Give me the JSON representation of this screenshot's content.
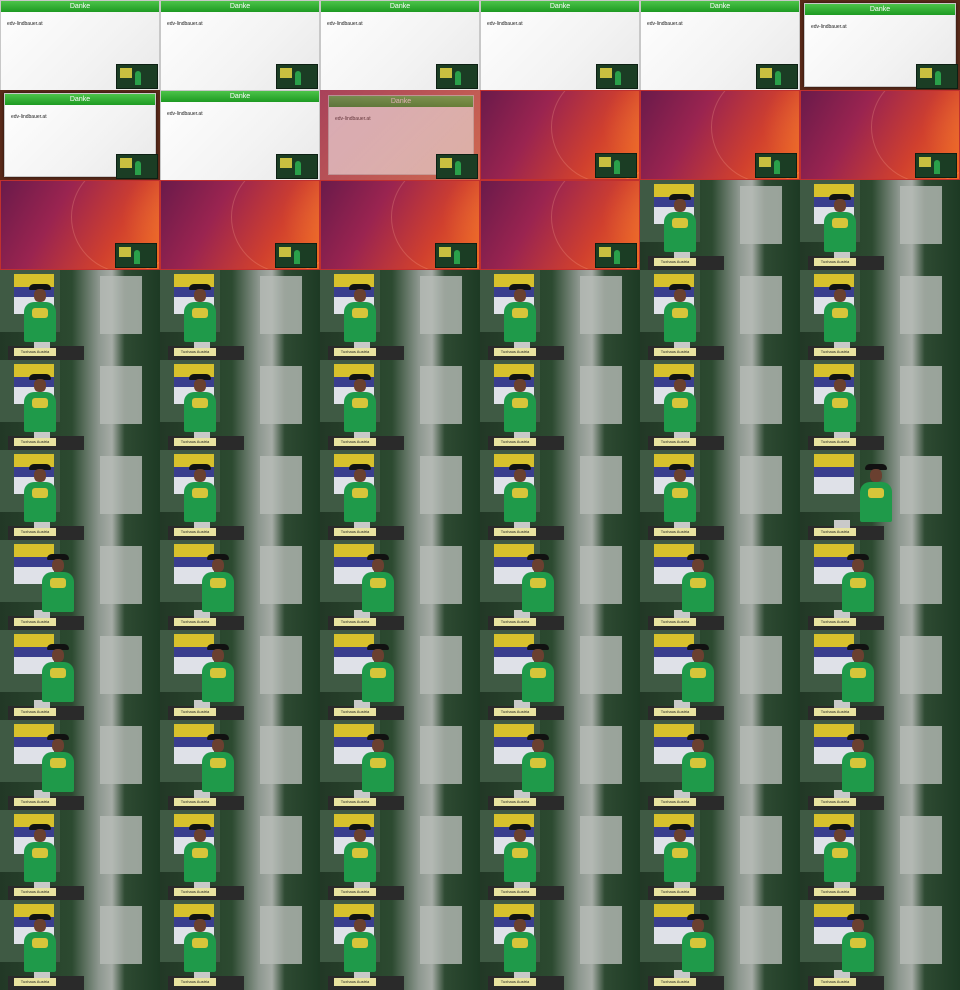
{
  "contact_sheet": {
    "columns": 6,
    "rows": 11,
    "tiles": [
      {
        "kind": "danke",
        "title": "Danke",
        "body": "edv-lindbauer.at"
      },
      {
        "kind": "danke",
        "title": "Danke",
        "body": "edv-lindbauer.at"
      },
      {
        "kind": "danke",
        "title": "Danke",
        "body": "edv-lindbauer.at"
      },
      {
        "kind": "danke",
        "title": "Danke",
        "body": "edv-lindbauer.at"
      },
      {
        "kind": "danke",
        "title": "Danke",
        "body": "edv-lindbauer.at"
      },
      {
        "kind": "danke-float",
        "title": "Danke",
        "body": "edv-lindbauer.at"
      },
      {
        "kind": "danke-float",
        "title": "Danke",
        "body": "edv-lindbauer.at"
      },
      {
        "kind": "danke",
        "title": "Danke",
        "body": "edv-lindbauer.at"
      },
      {
        "kind": "danke-fade",
        "title": "Danke",
        "body": "edv-lindbauer.at"
      },
      {
        "kind": "wallpaper"
      },
      {
        "kind": "wallpaper"
      },
      {
        "kind": "wallpaper"
      },
      {
        "kind": "wallpaper"
      },
      {
        "kind": "wallpaper"
      },
      {
        "kind": "wallpaper"
      },
      {
        "kind": "wallpaper"
      },
      {
        "kind": "camera",
        "placard": "Tuxhaus Austria",
        "pose": "left"
      },
      {
        "kind": "camera",
        "placard": "Tuxhaus Austria",
        "pose": "left"
      },
      {
        "kind": "camera",
        "placard": "Tuxhaus Austria",
        "pose": "left"
      },
      {
        "kind": "camera",
        "placard": "Tuxhaus Austria",
        "pose": "left"
      },
      {
        "kind": "camera",
        "placard": "Tuxhaus Austria",
        "pose": "left"
      },
      {
        "kind": "camera",
        "placard": "Tuxhaus Austria",
        "pose": "left"
      },
      {
        "kind": "camera",
        "placard": "Tuxhaus Austria",
        "pose": "left"
      },
      {
        "kind": "camera",
        "placard": "Tuxhaus Austria",
        "pose": "left"
      },
      {
        "kind": "camera",
        "placard": "Tuxhaus Austria",
        "pose": "left"
      },
      {
        "kind": "camera",
        "placard": "Tuxhaus Austria",
        "pose": "left"
      },
      {
        "kind": "camera",
        "placard": "Tuxhaus Austria",
        "pose": "left"
      },
      {
        "kind": "camera",
        "placard": "Tuxhaus Austria",
        "pose": "left"
      },
      {
        "kind": "camera",
        "placard": "Tuxhaus Austria",
        "pose": "left"
      },
      {
        "kind": "camera",
        "placard": "Tuxhaus Austria",
        "pose": "left"
      },
      {
        "kind": "camera",
        "placard": "Tuxhaus Austria",
        "pose": "left"
      },
      {
        "kind": "camera",
        "placard": "Tuxhaus Austria",
        "pose": "left"
      },
      {
        "kind": "camera",
        "placard": "Tuxhaus Austria",
        "pose": "left"
      },
      {
        "kind": "camera",
        "placard": "Tuxhaus Austria",
        "pose": "left"
      },
      {
        "kind": "camera",
        "placard": "Tuxhaus Austria",
        "pose": "left"
      },
      {
        "kind": "camera",
        "placard": "Tuxhaus Austria",
        "pose": "right"
      },
      {
        "kind": "camera",
        "placard": "Tuxhaus Austria",
        "pose": "center"
      },
      {
        "kind": "camera",
        "placard": "Tuxhaus Austria",
        "pose": "center"
      },
      {
        "kind": "camera",
        "placard": "Tuxhaus Austria",
        "pose": "center"
      },
      {
        "kind": "camera",
        "placard": "Tuxhaus Austria",
        "pose": "center"
      },
      {
        "kind": "camera",
        "placard": "Tuxhaus Austria",
        "pose": "center"
      },
      {
        "kind": "camera",
        "placard": "Tuxhaus Austria",
        "pose": "center"
      },
      {
        "kind": "camera",
        "placard": "Tuxhaus Austria",
        "pose": "center"
      },
      {
        "kind": "camera",
        "placard": "Tuxhaus Austria",
        "pose": "center"
      },
      {
        "kind": "camera",
        "placard": "Tuxhaus Austria",
        "pose": "center"
      },
      {
        "kind": "camera",
        "placard": "Tuxhaus Austria",
        "pose": "center"
      },
      {
        "kind": "camera",
        "placard": "Tuxhaus Austria",
        "pose": "center"
      },
      {
        "kind": "camera",
        "placard": "Tuxhaus Austria",
        "pose": "center"
      },
      {
        "kind": "camera",
        "placard": "Tuxhaus Austria",
        "pose": "center"
      },
      {
        "kind": "camera",
        "placard": "Tuxhaus Austria",
        "pose": "center"
      },
      {
        "kind": "camera",
        "placard": "Tuxhaus Austria",
        "pose": "center"
      },
      {
        "kind": "camera",
        "placard": "Tuxhaus Austria",
        "pose": "center"
      },
      {
        "kind": "camera",
        "placard": "Tuxhaus Austria",
        "pose": "center"
      },
      {
        "kind": "camera",
        "placard": "Tuxhaus Austria",
        "pose": "center"
      },
      {
        "kind": "camera",
        "placard": "Tuxhaus Austria",
        "pose": "left"
      },
      {
        "kind": "camera",
        "placard": "Tuxhaus Austria",
        "pose": "left"
      },
      {
        "kind": "camera",
        "placard": "Tuxhaus Austria",
        "pose": "left"
      },
      {
        "kind": "camera",
        "placard": "Tuxhaus Austria",
        "pose": "left"
      },
      {
        "kind": "camera",
        "placard": "Tuxhaus Austria",
        "pose": "left"
      },
      {
        "kind": "camera",
        "placard": "Tuxhaus Austria",
        "pose": "left"
      },
      {
        "kind": "camera",
        "placard": "Tuxhaus Austria",
        "pose": "left"
      },
      {
        "kind": "camera",
        "placard": "Tuxhaus Austria",
        "pose": "left"
      },
      {
        "kind": "camera",
        "placard": "Tuxhaus Austria",
        "pose": "left"
      },
      {
        "kind": "camera",
        "placard": "Tuxhaus Austria",
        "pose": "left"
      },
      {
        "kind": "camera",
        "placard": "Tuxhaus Austria",
        "pose": "center"
      },
      {
        "kind": "camera",
        "placard": "Tuxhaus Austria",
        "pose": "center"
      }
    ]
  },
  "colors": {
    "titlebar_green": "#2fb02f",
    "speaker_shirt": "#1f9a4a",
    "wallpaper_orange": "#f06a22",
    "wallpaper_purple": "#6a1a4a"
  }
}
